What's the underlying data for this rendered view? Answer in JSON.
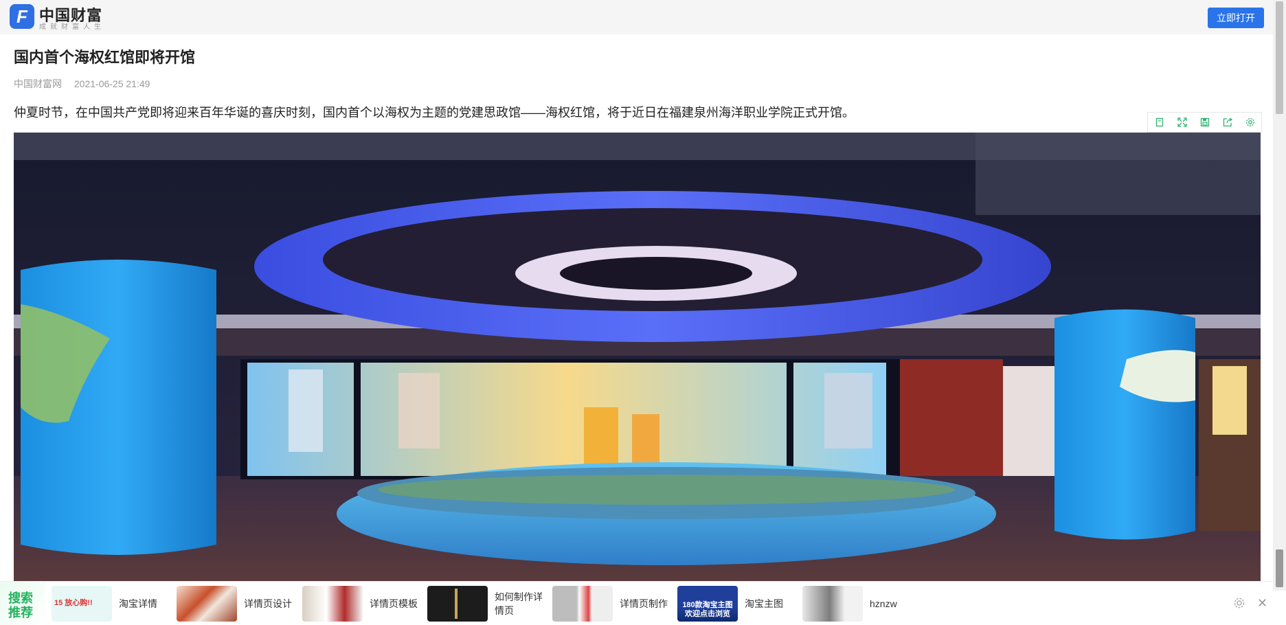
{
  "header": {
    "logo_glyph": "F",
    "brand_title": "中国财富",
    "brand_slogan": "成就财富人生",
    "open_button": "立即打开",
    "accent_color": "#2a74e9"
  },
  "article": {
    "title": "国内首个海权红馆即将开馆",
    "source": "中国财富网",
    "datetime": "2021-06-25 21:49",
    "lead": "仲夏时节，在中国共产党即将迎来百年华诞的喜庆时刻，国内首个以海权为主题的党建思政馆——海权红馆，将于近日在福建泉州海洋职业学院正式开馆。",
    "image_tools": [
      "read-mode-icon",
      "fullscreen-icon",
      "save-icon",
      "share-icon",
      "settings-icon"
    ]
  },
  "recommend": {
    "label_line1": "搜索",
    "label_line2": "推荐",
    "items": [
      {
        "label": "淘宝详情",
        "thumb_text": "15 放心购!!"
      },
      {
        "label": "详情页设计"
      },
      {
        "label": "详情页模板"
      },
      {
        "label": "如何制作详情页"
      },
      {
        "label": "详情页制作"
      },
      {
        "label": "淘宝主图",
        "thumb_text": "180款淘宝主图 欢迎点击浏览"
      },
      {
        "label": "hznzw"
      }
    ],
    "close_glyph": "✕"
  }
}
